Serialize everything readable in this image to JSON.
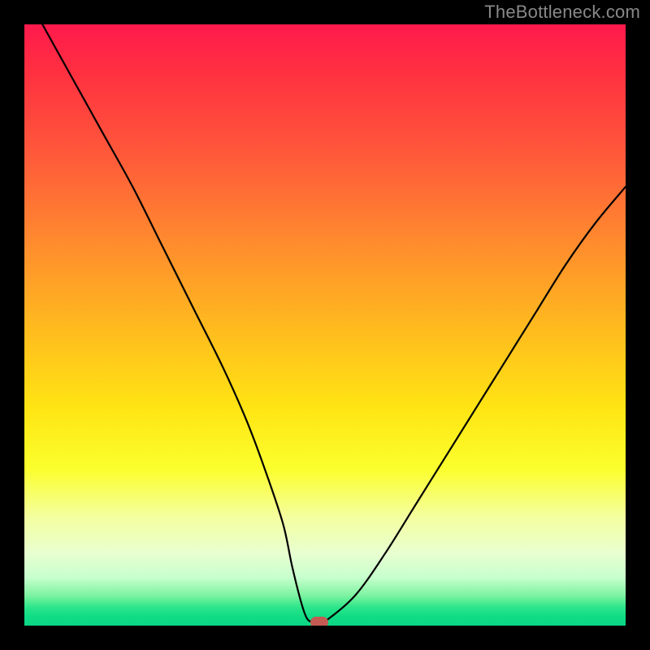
{
  "watermark": "TheBottleneck.com",
  "chart_data": {
    "type": "line",
    "title": "",
    "xlabel": "",
    "ylabel": "",
    "xlim": [
      0,
      100
    ],
    "ylim": [
      0,
      100
    ],
    "series": [
      {
        "name": "curve",
        "x": [
          3,
          8,
          13,
          18,
          23,
          28,
          33,
          37,
          40,
          43,
          44.5,
          46,
          47,
          48,
          49,
          50,
          55,
          60,
          65,
          70,
          75,
          80,
          85,
          90,
          95,
          100
        ],
        "y": [
          100,
          91,
          82,
          73,
          63,
          53,
          43,
          34,
          26,
          17,
          10,
          4,
          1.2,
          0.6,
          0.6,
          0.7,
          5,
          12,
          20,
          28,
          36,
          44,
          52,
          60,
          67,
          73
        ]
      }
    ],
    "marker": {
      "x": 49,
      "y": 0.6
    },
    "background": "red-yellow-green vertical gradient",
    "note": "Values estimated from pixel positions; axes are unlabeled in the source image."
  }
}
